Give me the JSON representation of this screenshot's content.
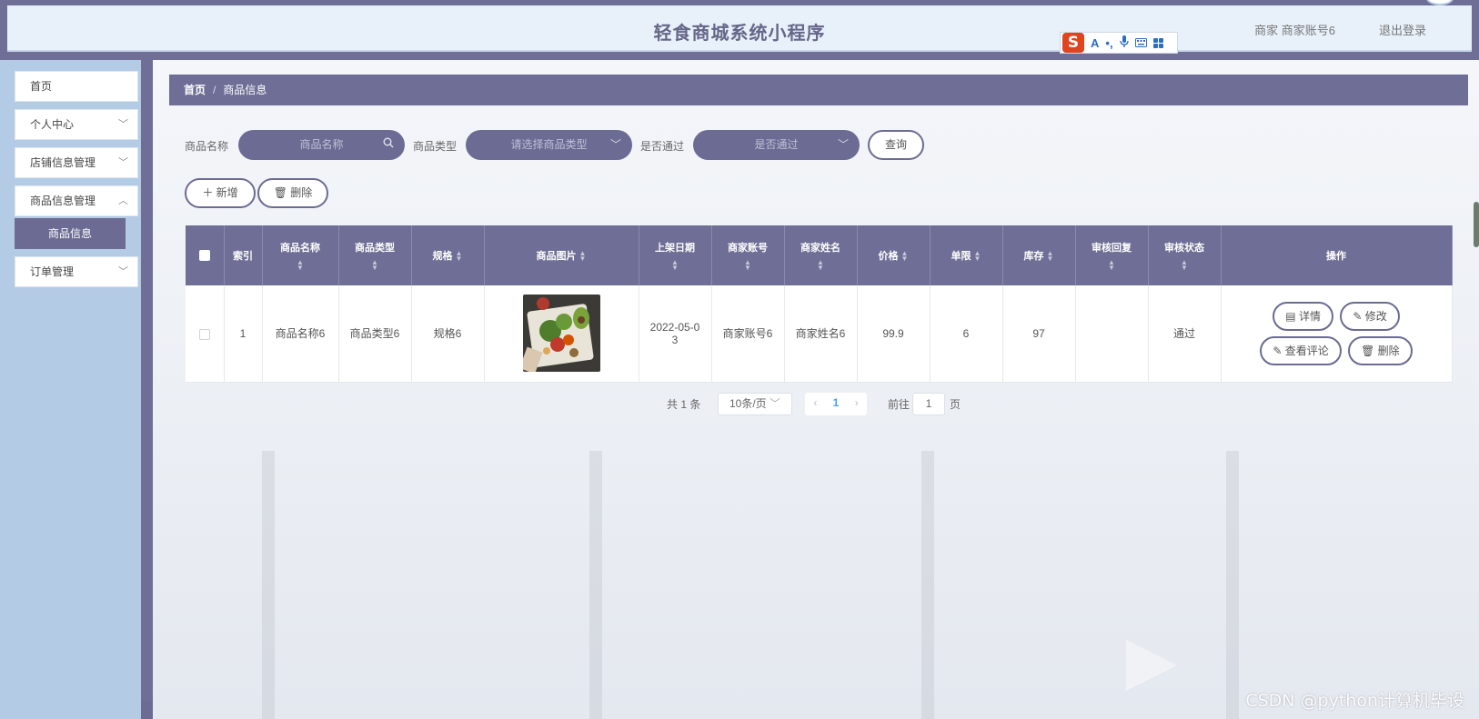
{
  "header": {
    "title": "轻食商城系统小程序",
    "user_label": "商家 商家账号6",
    "logout_label": "退出登录"
  },
  "ime_toolbar": {
    "logo": "S",
    "items": [
      "A",
      "•,",
      "🎤",
      "⌨"
    ]
  },
  "sidebar": {
    "items": [
      {
        "label": "首页",
        "expandable": false
      },
      {
        "label": "个人中心",
        "expandable": true
      },
      {
        "label": "店铺信息管理",
        "expandable": true
      },
      {
        "label": "商品信息管理",
        "expandable": true,
        "expanded": true
      },
      {
        "label": "订单管理",
        "expandable": true
      }
    ],
    "active_subitem": "商品信息"
  },
  "breadcrumb": {
    "home": "首页",
    "separator": "/",
    "current": "商品信息"
  },
  "search": {
    "name_label": "商品名称",
    "name_placeholder": "商品名称",
    "type_label": "商品类型",
    "type_placeholder": "请选择商品类型",
    "approved_label": "是否通过",
    "approved_placeholder": "是否通过",
    "query_button": "查询"
  },
  "actions": {
    "add_label": "新增",
    "delete_label": "删除"
  },
  "table": {
    "columns": [
      "索引",
      "商品名称",
      "商品类型",
      "规格",
      "商品图片",
      "上架日期",
      "商家账号",
      "商家姓名",
      "价格",
      "单限",
      "库存",
      "审核回复",
      "审核状态",
      "操作"
    ],
    "rows": [
      {
        "index": "1",
        "name": "商品名称6",
        "type": "商品类型6",
        "spec": "规格6",
        "date_line1": "2022-05-0",
        "date_line2": "3",
        "merchant_account": "商家账号6",
        "merchant_name": "商家姓名6",
        "price": "99.9",
        "limit": "6",
        "stock": "97",
        "review_reply": "",
        "review_status": "通过",
        "ops": {
          "detail": "详情",
          "edit": "修改",
          "view_comments": "查看评论",
          "delete": "删除"
        }
      }
    ]
  },
  "pagination": {
    "total": "共 1 条",
    "page_size": "10条/页",
    "current_page": "1",
    "goto_label": "前往",
    "goto_value": "1",
    "page_suffix": "页"
  },
  "watermark": {
    "text": "CSDN @python计算机毕设"
  },
  "colors": {
    "primary": "#6e6e96",
    "sidebar_bg": "#b4cbe6",
    "header_bg": "#e8f1fa"
  }
}
